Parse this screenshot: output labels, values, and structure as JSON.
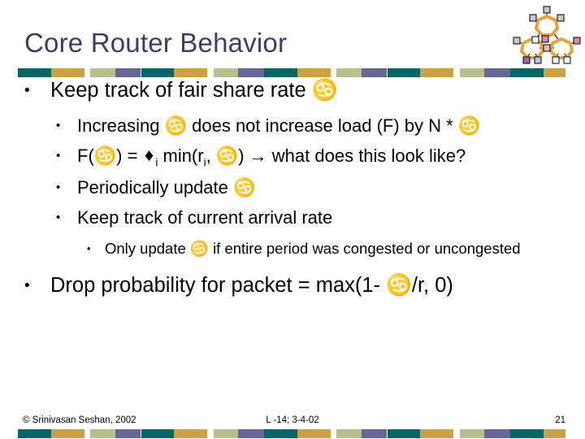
{
  "slide": {
    "title": "Core Router Behavior",
    "title_color": "#3b3f66",
    "background_color": "#ffffff"
  },
  "logo": {
    "name": "network-rings-logo",
    "ring_color": "#E8A33D",
    "node_fill": "#C8C8C8",
    "accent_pink": "#D98CA8",
    "accent_purple": "#9B8BC0",
    "link_color": "#000000"
  },
  "decor": {
    "stripe_colors": [
      "#006666",
      "#cba143",
      "#b8bf8c",
      "#666699"
    ]
  },
  "content": {
    "bullets": [
      {
        "level": 1,
        "marker": "•",
        "text": "Keep track of fair share rate ♋"
      },
      {
        "level": 2,
        "marker": "•",
        "text": "Increasing ♋ does not increase load (F) by N * ♋"
      },
      {
        "level": 2,
        "marker": "•",
        "text_parts": {
          "p1": "F(♋) = ",
          "sigma": "♦",
          "sub": "i",
          "p2": " min(r",
          "sub2": "i",
          "p3": ", ♋) → what does this look like?"
        }
      },
      {
        "level": 2,
        "marker": "•",
        "text": "Periodically update ♋"
      },
      {
        "level": 2,
        "marker": "•",
        "text": "Keep track of current arrival rate"
      },
      {
        "level": 3,
        "marker": "•",
        "text": "Only update ♋ if entire period was congested or uncongested"
      },
      {
        "level": 1,
        "marker": "•",
        "text": "Drop probability for packet = max(1- ♋/r, 0)"
      }
    ]
  },
  "footer": {
    "copyright": "© Srinivasan Seshan, 2002",
    "lecture": "L -14; 3-4-02",
    "page_number": "21"
  }
}
